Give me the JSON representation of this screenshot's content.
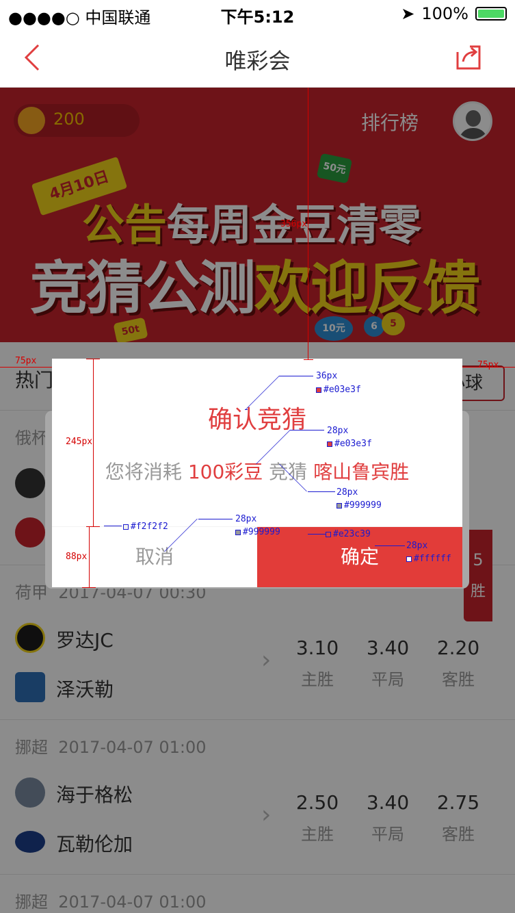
{
  "status_bar": {
    "carrier": "●●●●○ 中国联通",
    "time": "下午5:12",
    "battery": "100%"
  },
  "nav": {
    "title": "唯彩会"
  },
  "banner": {
    "beans": "200",
    "rank": "排行榜",
    "flag_date": "4月10日",
    "notice_line1_a": "公告",
    "notice_line1_b": "每周金豆清零",
    "notice_line2_a": "竞猜公测",
    "notice_line2_b": "欢迎反馈",
    "chips": [
      "50元",
      "50t",
      "10元",
      "6",
      "5"
    ]
  },
  "tabs": {
    "hot": "热门",
    "ball": "小球"
  },
  "sections": [
    {
      "league": "俄杯",
      "time": "",
      "home": "",
      "away": "",
      "odds": []
    },
    {
      "league": "荷甲",
      "time": "2017-04-07 00:30",
      "home": "罗达JC",
      "away": "泽沃勒",
      "odds": [
        {
          "v": "3.10",
          "l": "主胜"
        },
        {
          "v": "3.40",
          "l": "平局"
        },
        {
          "v": "2.20",
          "l": "客胜"
        }
      ]
    },
    {
      "league": "挪超",
      "time": "2017-04-07 01:00",
      "home": "海于格松",
      "away": "瓦勒伦加",
      "odds": [
        {
          "v": "2.50",
          "l": "主胜"
        },
        {
          "v": "3.40",
          "l": "平局"
        },
        {
          "v": "2.75",
          "l": "客胜"
        }
      ]
    },
    {
      "league": "挪超",
      "time": "2017-04-07 01:00"
    }
  ],
  "peek": {
    "v": "5",
    "l": "胜"
  },
  "modal": {
    "title": "确认竞猜",
    "body_a": "您将消耗",
    "body_amount": "100彩豆",
    "body_b": "竞猜",
    "body_pick": "喀山鲁宾胜",
    "cancel": "取消",
    "confirm": "确定"
  },
  "annotations": {
    "w_banner": "356px",
    "left_margin": "75px",
    "right_margin": "75px",
    "h_body": "245px",
    "h_buttons": "88px",
    "title_size": "36px",
    "title_color": "#e03e3f",
    "amount_size": "28px",
    "amount_color": "#e03e3f",
    "grey_size": "28px",
    "grey_color": "#999999",
    "divider_color": "#f2f2f2",
    "cancel_size": "28px",
    "cancel_color": "#999999",
    "ok_bg": "#e23c39",
    "ok_size": "28px",
    "ok_color": "#ffffff"
  }
}
